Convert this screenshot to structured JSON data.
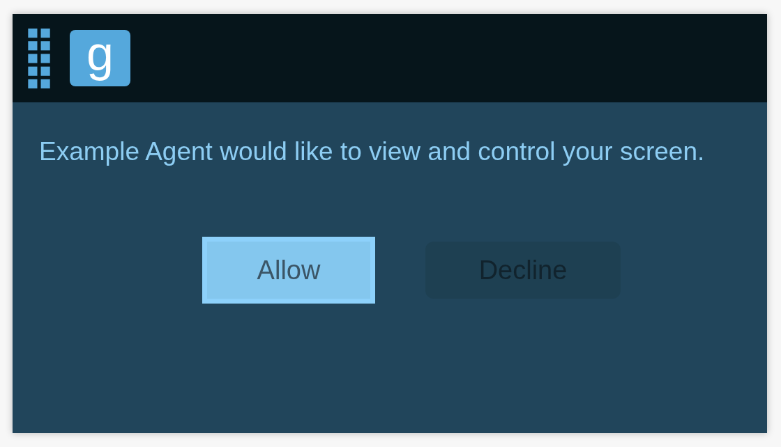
{
  "header": {
    "logo": "g"
  },
  "message": "Example Agent would like to view and control your screen.",
  "buttons": [
    {
      "label": "Allow",
      "kind": "primary",
      "focused": true
    },
    {
      "label": "Decline",
      "kind": "secondary",
      "focused": false
    }
  ]
}
